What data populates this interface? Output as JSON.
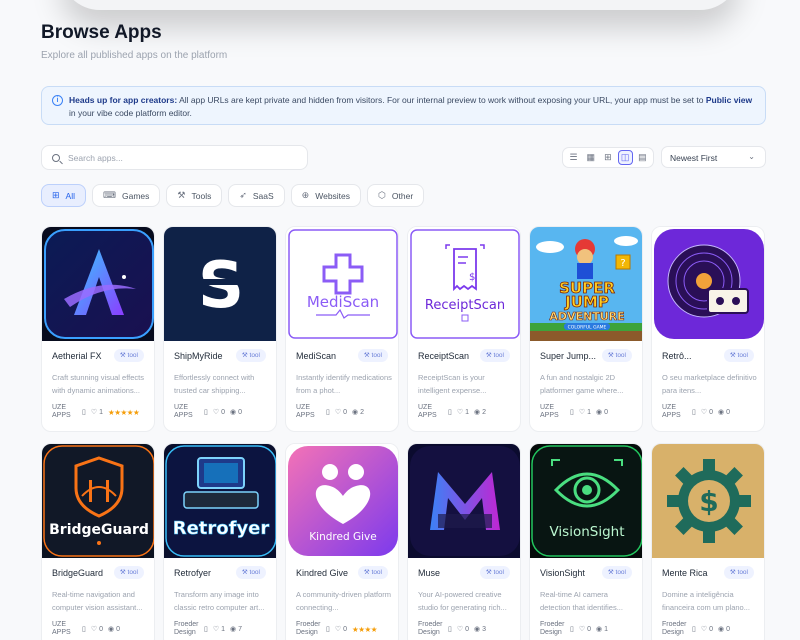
{
  "header": {
    "title": "Browse Apps",
    "subtitle": "Explore all published apps on the platform"
  },
  "notice": {
    "bold_prefix": "Heads up for app creators:",
    "text_before_link": " All app URLs are kept private and hidden from visitors. For our internal preview to work without exposing your URL, your app must be set to ",
    "link": "Public view",
    "text_after_link": " in your vibe code platform editor."
  },
  "search": {
    "placeholder": "Search apps..."
  },
  "view_modes": [
    {
      "icon": "list-icon",
      "glyph": "☰",
      "active": false
    },
    {
      "icon": "grid-small-icon",
      "glyph": "▦",
      "active": false
    },
    {
      "icon": "grid-icon",
      "glyph": "⊞",
      "active": false
    },
    {
      "icon": "columns-icon",
      "glyph": "◫",
      "active": true
    },
    {
      "icon": "film-icon",
      "glyph": "▤",
      "active": false
    }
  ],
  "sort": {
    "selected": "Newest First"
  },
  "filters": [
    {
      "label": "All",
      "icon": "grid-icon",
      "glyph": "⊞",
      "active": true
    },
    {
      "label": "Games",
      "icon": "gamepad-icon",
      "glyph": "⌨",
      "active": false
    },
    {
      "label": "Tools",
      "icon": "wrench-icon",
      "glyph": "⚒",
      "active": false
    },
    {
      "label": "SaaS",
      "icon": "rocket-icon",
      "glyph": "➶",
      "active": false
    },
    {
      "label": "Websites",
      "icon": "globe-icon",
      "glyph": "⊕",
      "active": false
    },
    {
      "label": "Other",
      "icon": "cube-icon",
      "glyph": "⬡",
      "active": false
    }
  ],
  "apps": [
    {
      "name": "Aetherial FX",
      "tag": "tool",
      "desc": "Craft stunning visual effects with dynamic animations...",
      "author": "UZE APPS",
      "likes": "1",
      "saves": "",
      "views": "",
      "rating": 5
    },
    {
      "name": "ShipMyRide",
      "tag": "tool",
      "desc": "Effortlessly connect with trusted car shipping...",
      "author": "UZE APPS",
      "likes": "0",
      "saves": "",
      "views": "0",
      "rating": 0
    },
    {
      "name": "MediScan",
      "tag": "tool",
      "desc": "Instantly identify medications from a phot...",
      "author": "UZE APPS",
      "likes": "0",
      "saves": "",
      "views": "2",
      "rating": 0
    },
    {
      "name": "ReceiptScan",
      "tag": "tool",
      "desc": "ReceiptScan is your intelligent expense...",
      "author": "UZE APPS",
      "likes": "1",
      "saves": "",
      "views": "2",
      "rating": 0
    },
    {
      "name": "Super Jump...",
      "tag": "tool",
      "desc": "A fun and nostalgic 2D platformer game where...",
      "author": "UZE APPS",
      "likes": "1",
      "saves": "",
      "views": "0",
      "rating": 0
    },
    {
      "name": "Retrô...",
      "tag": "tool",
      "desc": "O seu marketplace definitivo para itens...",
      "author": "UZE APPS",
      "likes": "0",
      "saves": "",
      "views": "0",
      "rating": 0
    },
    {
      "name": "BridgeGuard",
      "tag": "tool",
      "desc": "Real-time navigation and computer vision assistant...",
      "author": "UZE APPS",
      "likes": "0",
      "saves": "",
      "views": "0",
      "rating": 0
    },
    {
      "name": "Retrofyer",
      "tag": "tool",
      "desc": "Transform any image into classic retro computer art...",
      "author": "Froeder Design",
      "likes": "1",
      "saves": "",
      "views": "7",
      "rating": 0
    },
    {
      "name": "Kindred Give",
      "tag": "tool",
      "desc": "A community-driven platform connecting...",
      "author": "Froeder Design",
      "likes": "0",
      "saves": "",
      "views": "",
      "rating": 4
    },
    {
      "name": "Muse",
      "tag": "tool",
      "desc": "Your AI-powered creative studio for generating rich...",
      "author": "Froeder Design",
      "likes": "0",
      "saves": "",
      "views": "3",
      "rating": 0
    },
    {
      "name": "VisionSight",
      "tag": "tool",
      "desc": "Real-time AI camera detection that identifies...",
      "author": "Froeder Design",
      "likes": "0",
      "saves": "",
      "views": "1",
      "rating": 0
    },
    {
      "name": "Mente Rica",
      "tag": "tool",
      "desc": "Domine a inteligência financeira com um plano...",
      "author": "Froeder Design",
      "likes": "0",
      "saves": "",
      "views": "0",
      "rating": 0
    }
  ],
  "thumb_text": {
    "mediscan": "MediScan",
    "receiptscan": "ReceiptScan",
    "super": "SUPER",
    "jump": "JUMP",
    "adventure": "ADVENTURE",
    "colorful": "COLORFUL GAME",
    "bridgeguard": "BridgeGuard",
    "retrofyer": "Retrofyer",
    "kindred": "Kindred Give",
    "visionsight": "VisionSight"
  },
  "colors": {
    "accent": "#2563eb",
    "star": "#f59e0b",
    "tag_bg": "#eef2ff"
  }
}
